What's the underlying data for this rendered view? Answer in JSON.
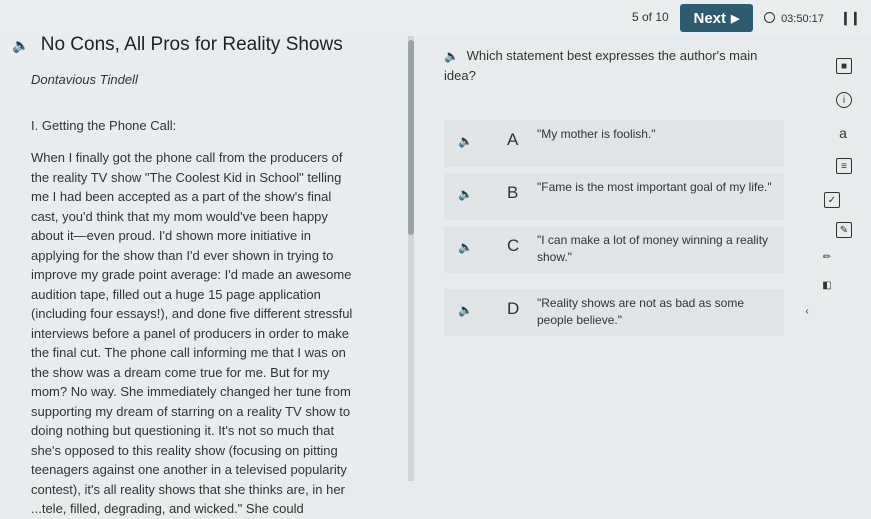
{
  "header": {
    "progress": "5 of 10",
    "next_label": "Next",
    "next_icon": "triangle-right-icon",
    "timer": "03:50:17",
    "pause_icon": "pause-icon"
  },
  "passage": {
    "title": "No Cons, All Pros for Reality Shows",
    "author": "Dontavious Tindell",
    "section": "I. Getting the Phone Call:",
    "lines": [
      "When I finally got the phone call from the producers of",
      "the reality TV show \"The Coolest Kid in School\" telling",
      "me I had been accepted as a part of the show's final",
      "cast, you'd think that my mom would've been happy",
      "about it—even proud. I'd shown more initiative in",
      "applying for the show than I'd ever shown in trying to",
      "improve my grade point average: I'd made an awesome",
      "audition tape, filled out a huge 15 page application",
      "(including four essays!), and done five different stressful",
      "interviews before a panel of producers in order to make",
      "the final cut. The phone call informing me that I was on",
      "the show was a dream come true for me. But for my",
      "mom? No way. She immediately changed her tune from",
      "supporting my dream of starring on a reality TV show to",
      "doing nothing but questioning it. It's not so much that",
      "she's opposed to this reality show (focusing on pitting",
      "teenagers against one another in a televised popularity",
      "contest), it's all reality shows that she thinks are, in her",
      "...tele, filled, degrading, and wicked.\" She could"
    ]
  },
  "question": {
    "text": "Which statement best expresses the author's main idea?",
    "options": [
      {
        "letter": "A",
        "text": "\"My mother is foolish.\""
      },
      {
        "letter": "B",
        "text": "\"Fame is the most important goal of my life.\""
      },
      {
        "letter": "C",
        "text": "\"I can make a lot of money winning a reality show.\""
      },
      {
        "letter": "D",
        "text": "\"Reality shows are not as bad as some people believe.\""
      }
    ]
  },
  "toolbar": {
    "tools": [
      "bookmark-icon",
      "info-icon",
      "text-size-icon",
      "calculator-icon",
      "eliminator-icon",
      "notes-icon",
      "highlighter-icon",
      "eraser-icon",
      "collapse-icon"
    ]
  }
}
